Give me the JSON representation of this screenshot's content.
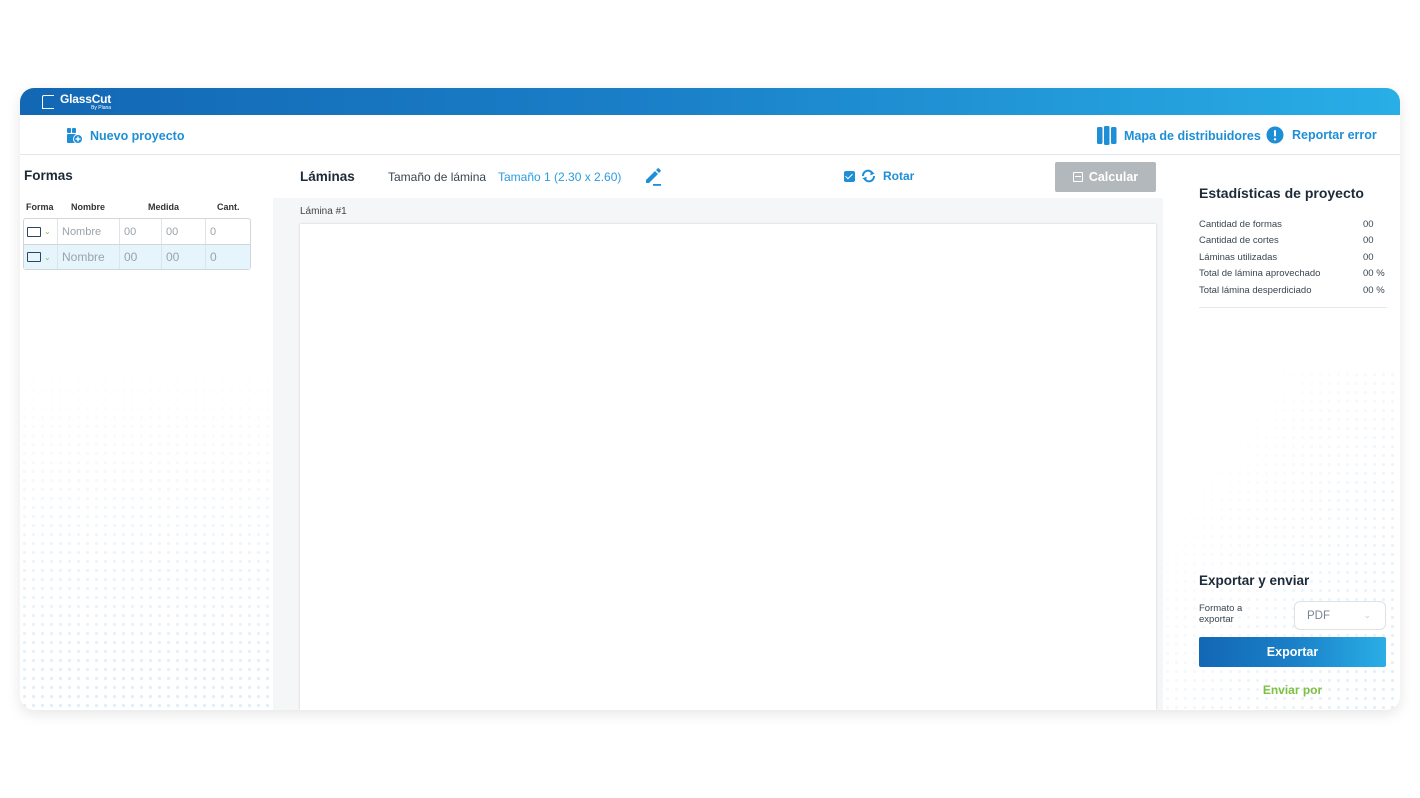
{
  "app": {
    "name": "GlassCut",
    "subtitle": "By Plana"
  },
  "toolbar": {
    "new_project": "Nuevo proyecto",
    "distributors_map": "Mapa de distribuidores",
    "report_error": "Reportar error"
  },
  "shapes": {
    "title": "Formas",
    "columns": [
      "Forma",
      "Nombre",
      "Medida",
      "Cant."
    ],
    "rows": [
      {
        "shape": "rectangle-icon",
        "name": "Nombre",
        "width": "00",
        "height": "00",
        "qty": "0",
        "selected": false
      },
      {
        "shape": "rectangle-icon",
        "name": "Nombre",
        "width": "00",
        "height": "00",
        "qty": "0",
        "selected": true
      }
    ]
  },
  "sheets": {
    "title": "Láminas",
    "size_label": "Tamaño de lámina",
    "size_value": "Tamaño 1 (2.30 x 2.60)",
    "rotate_label": "Rotar",
    "rotate_checked": true,
    "calculate_label": "Calcular",
    "current_sheet_label": "Lámina #1"
  },
  "stats": {
    "title": "Estadísticas de proyecto",
    "items": [
      {
        "label": "Cantidad de formas",
        "value": "00"
      },
      {
        "label": "Cantidad de cortes",
        "value": "00"
      },
      {
        "label": "Láminas utilizadas",
        "value": "00"
      },
      {
        "label": "Total de lámina aprovechado",
        "value": "00 %"
      },
      {
        "label": "Total lámina desperdiciado",
        "value": "00 %"
      }
    ]
  },
  "export": {
    "title": "Exportar y enviar",
    "format_label": "Formato a exportar",
    "format_value": "PDF",
    "export_button": "Exportar",
    "send_link": "Enviar por"
  },
  "colors": {
    "accent": "#1e8fd6",
    "brand_start": "#1367b4",
    "brand_end": "#29aee6",
    "send_green": "#7cc142",
    "disabled_button": "#b3b8bc"
  }
}
